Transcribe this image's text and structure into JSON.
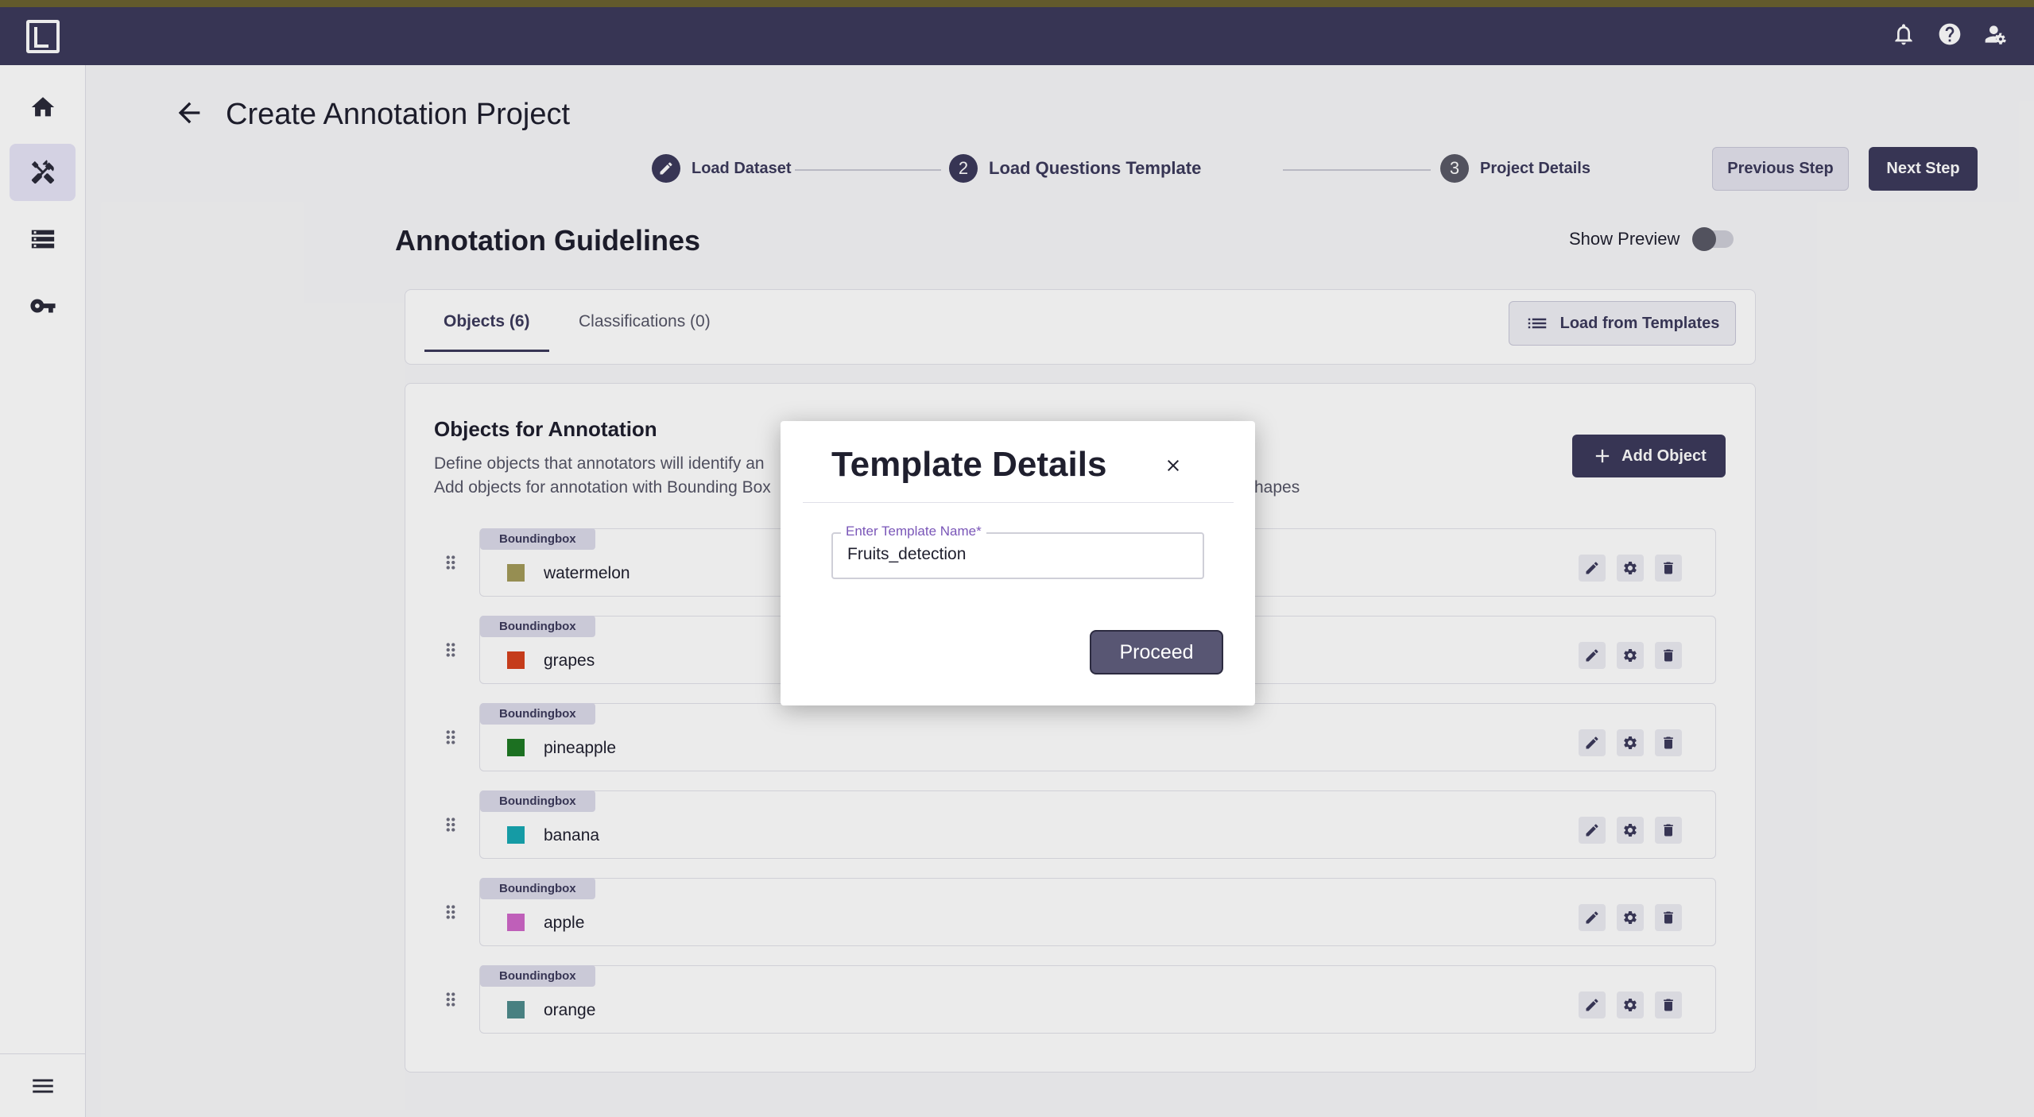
{
  "topbar": {
    "icons": [
      "bell-icon",
      "help-icon",
      "user-settings-icon"
    ]
  },
  "sidebar": {
    "items": [
      {
        "name": "home",
        "icon": "home-icon",
        "active": false
      },
      {
        "name": "tools",
        "icon": "tools-icon",
        "active": true
      },
      {
        "name": "list",
        "icon": "list-icon",
        "active": false
      },
      {
        "name": "key",
        "icon": "key-icon",
        "active": false
      }
    ],
    "bottom_icon": "menu-icon"
  },
  "page": {
    "title": "Create Annotation Project"
  },
  "stepper": {
    "steps": [
      {
        "number": "",
        "label": "Load Dataset",
        "state": "done"
      },
      {
        "number": "2",
        "label": "Load Questions Template",
        "state": "current"
      },
      {
        "number": "3",
        "label": "Project Details",
        "state": "pending"
      }
    ]
  },
  "nav": {
    "prev_label": "Previous Step",
    "next_label": "Next Step"
  },
  "guidelines": {
    "title": "Annotation Guidelines",
    "preview_label": "Show Preview",
    "preview_on": false
  },
  "tabs": {
    "objects": "Objects (6)",
    "classifications": "Classifications (0)",
    "load_templates": "Load from Templates"
  },
  "objects": {
    "title": "Objects for Annotation",
    "desc_line1": "Define objects that annotators will identify an",
    "desc_line2": "Add objects for annotation with Bounding Box",
    "desc_line2_end": "hapes",
    "add_label": "Add Object",
    "items": [
      {
        "type": "Boundingbox",
        "name": "watermelon",
        "color": "#a39b5a"
      },
      {
        "type": "Boundingbox",
        "name": "grapes",
        "color": "#d6421e"
      },
      {
        "type": "Boundingbox",
        "name": "pineapple",
        "color": "#1f7a24"
      },
      {
        "type": "Boundingbox",
        "name": "banana",
        "color": "#17a9b4"
      },
      {
        "type": "Boundingbox",
        "name": "apple",
        "color": "#d068c9"
      },
      {
        "type": "Boundingbox",
        "name": "orange",
        "color": "#4f8b8c"
      }
    ]
  },
  "modal": {
    "title": "Template Details",
    "field_label": "Enter Template Name*",
    "field_value": "Fruits_detection",
    "proceed_label": "Proceed"
  }
}
